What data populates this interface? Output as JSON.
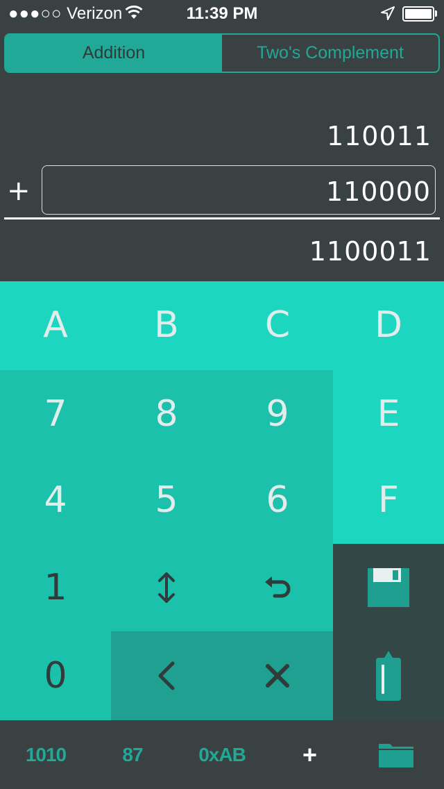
{
  "status_bar": {
    "signal": "●●●○○",
    "carrier": "Verizon",
    "time": "11:39 PM"
  },
  "segments": [
    {
      "label": "Addition",
      "active": true
    },
    {
      "label": "Two's Complement",
      "active": false
    }
  ],
  "calculator": {
    "operand1": "110011",
    "operator": "+",
    "operand2": "110000",
    "result": "1100011"
  },
  "keys": {
    "a": "A",
    "b": "B",
    "c": "C",
    "d": "D",
    "k7": "7",
    "k8": "8",
    "k9": "9",
    "e": "E",
    "k4": "4",
    "k5": "5",
    "k6": "6",
    "f": "F",
    "k1": "1",
    "k0": "0"
  },
  "icons": {
    "swap": "swap-vertical-icon",
    "undo": "undo-icon",
    "save": "floppy-disk-icon",
    "clear_all": "paste-bottle-icon",
    "back": "chevron-left-icon",
    "delete": "times-icon",
    "folder": "folder-icon"
  },
  "bottom_bar": {
    "binary": "1010",
    "decimal": "87",
    "hex": "0xAB",
    "operation": "+"
  },
  "colors": {
    "background": "#3a4142",
    "accent": "#21a896",
    "pad_light": "#1dd6bf",
    "pad_mid": "#1bc1ab",
    "pad_deep": "#20a090",
    "pad_slate": "#334846"
  }
}
